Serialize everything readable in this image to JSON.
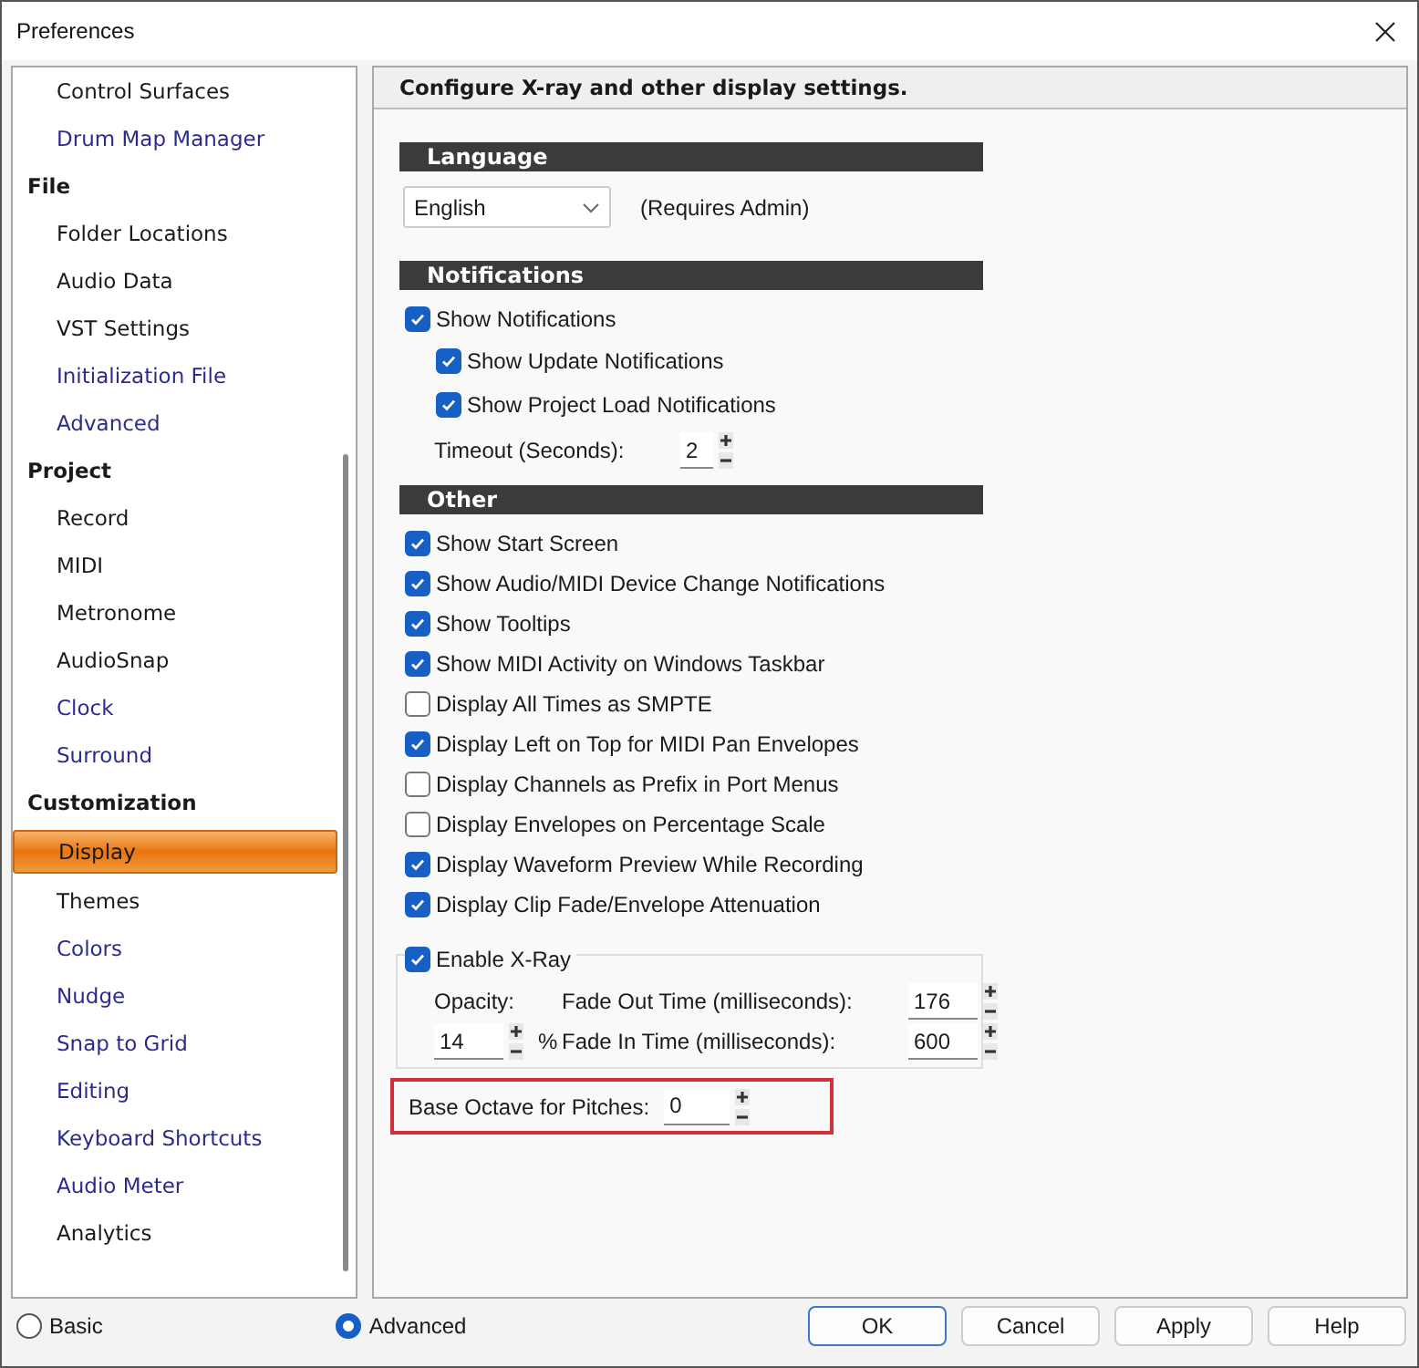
{
  "window": {
    "title": "Preferences"
  },
  "sidebar": {
    "groups": [
      {
        "items": [
          {
            "label": "Control Surfaces",
            "advanced": false,
            "selected": false
          },
          {
            "label": "Drum Map Manager",
            "advanced": true,
            "selected": false
          }
        ]
      },
      {
        "label": "File",
        "items": [
          {
            "label": "Folder Locations",
            "advanced": false,
            "selected": false
          },
          {
            "label": "Audio Data",
            "advanced": false,
            "selected": false
          },
          {
            "label": "VST Settings",
            "advanced": false,
            "selected": false
          },
          {
            "label": "Initialization File",
            "advanced": true,
            "selected": false
          },
          {
            "label": "Advanced",
            "advanced": true,
            "selected": false
          }
        ]
      },
      {
        "label": "Project",
        "items": [
          {
            "label": "Record",
            "advanced": false,
            "selected": false
          },
          {
            "label": "MIDI",
            "advanced": false,
            "selected": false
          },
          {
            "label": "Metronome",
            "advanced": false,
            "selected": false
          },
          {
            "label": "AudioSnap",
            "advanced": false,
            "selected": false
          },
          {
            "label": "Clock",
            "advanced": true,
            "selected": false
          },
          {
            "label": "Surround",
            "advanced": true,
            "selected": false
          }
        ]
      },
      {
        "label": "Customization",
        "items": [
          {
            "label": "Display",
            "advanced": false,
            "selected": true
          },
          {
            "label": "Themes",
            "advanced": false,
            "selected": false
          },
          {
            "label": "Colors",
            "advanced": true,
            "selected": false
          },
          {
            "label": "Nudge",
            "advanced": true,
            "selected": false
          },
          {
            "label": "Snap to Grid",
            "advanced": true,
            "selected": false
          },
          {
            "label": "Editing",
            "advanced": true,
            "selected": false
          },
          {
            "label": "Keyboard Shortcuts",
            "advanced": true,
            "selected": false
          },
          {
            "label": "Audio Meter",
            "advanced": true,
            "selected": false
          },
          {
            "label": "Analytics",
            "advanced": false,
            "selected": false
          }
        ]
      }
    ]
  },
  "panel": {
    "header": "Configure X-ray and other display settings.",
    "language": {
      "heading": "Language",
      "value": "English",
      "note": "(Requires Admin)"
    },
    "notifications": {
      "heading": "Notifications",
      "options": [
        {
          "label": "Show Notifications",
          "checked": true,
          "children": [
            {
              "label": "Show Update Notifications",
              "checked": true
            },
            {
              "label": "Show Project Load Notifications",
              "checked": true
            }
          ]
        }
      ],
      "timeout": {
        "label": "Timeout (Seconds):",
        "value": "2"
      }
    },
    "other": {
      "heading": "Other",
      "options": [
        {
          "label": "Show Start Screen",
          "checked": true
        },
        {
          "label": "Show Audio/MIDI Device Change Notifications",
          "checked": true
        },
        {
          "label": "Show Tooltips",
          "checked": true
        },
        {
          "label": "Show MIDI Activity on Windows Taskbar",
          "checked": true
        },
        {
          "label": "Display All Times as SMPTE",
          "checked": false
        },
        {
          "label": "Display Left on Top for MIDI Pan Envelopes",
          "checked": true
        },
        {
          "label": "Display Channels as Prefix in Port Menus",
          "checked": false
        },
        {
          "label": "Display Envelopes on Percentage Scale",
          "checked": false
        },
        {
          "label": "Display Waveform Preview While Recording",
          "checked": true
        },
        {
          "label": "Display Clip Fade/Envelope Attenuation",
          "checked": true
        }
      ]
    },
    "xray": {
      "label": "Enable X-Ray",
      "checked": true,
      "opacity_label": "Opacity:",
      "opacity": "14",
      "unit": "%",
      "fade_out": {
        "label": "Fade Out Time (milliseconds):",
        "value": "176"
      },
      "fade_in": {
        "label": "Fade In Time (milliseconds):",
        "value": "600"
      }
    },
    "base_octave": {
      "label": "Base Octave for Pitches:",
      "value": "0",
      "highlighted": true
    }
  },
  "footer": {
    "modes": [
      {
        "label": "Basic",
        "selected": false
      },
      {
        "label": "Advanced",
        "selected": true
      }
    ],
    "buttons": [
      {
        "label": "OK",
        "default": true
      },
      {
        "label": "Cancel",
        "default": false
      },
      {
        "label": "Apply",
        "default": false
      },
      {
        "label": "Help",
        "default": false
      }
    ]
  }
}
